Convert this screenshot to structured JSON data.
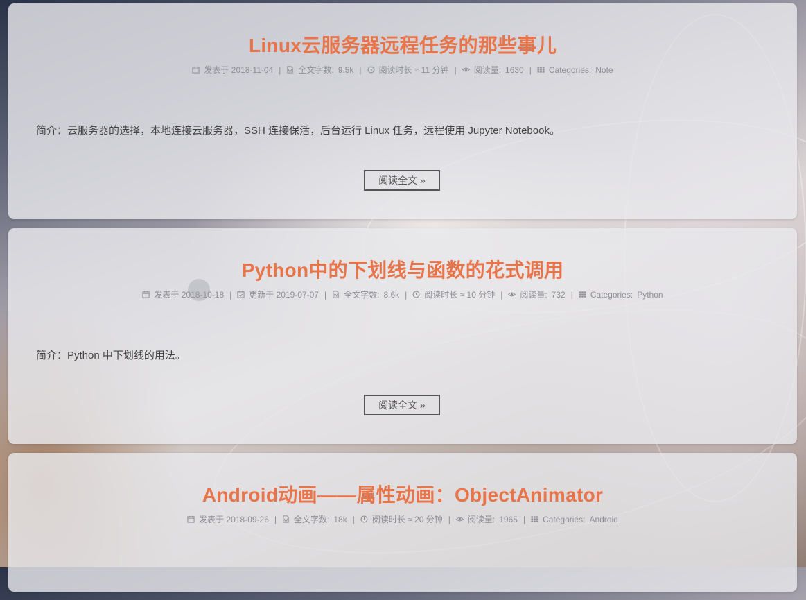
{
  "posts": [
    {
      "title": "Linux云服务器远程任务的那些事儿",
      "posted": "发表于 2018-11-04",
      "wordcount_label": "全文字数:",
      "wordcount": "9.5k",
      "readtime": "阅读时长 ≈ 11 分钟",
      "views_label": "阅读量:",
      "views": "1630",
      "categories_label": "Categories:",
      "category": "Note",
      "excerpt": "简介：云服务器的选择，本地连接云服务器，SSH 连接保活，后台运行 Linux 任务，远程使用 Jupyter Notebook。",
      "read_more": "阅读全文 »"
    },
    {
      "title": "Python中的下划线与函数的花式调用",
      "posted": "发表于 2018-10-18",
      "updated": "更新于 2019-07-07",
      "wordcount_label": "全文字数:",
      "wordcount": "8.6k",
      "readtime": "阅读时长 ≈ 10 分钟",
      "views_label": "阅读量:",
      "views": "732",
      "categories_label": "Categories:",
      "category": "Python",
      "excerpt": "简介：Python 中下划线的用法。",
      "read_more": "阅读全文 »"
    },
    {
      "title": "Android动画——属性动画：ObjectAnimator",
      "posted": "发表于 2018-09-26",
      "wordcount_label": "全文字数:",
      "wordcount": "18k",
      "readtime": "阅读时长 ≈ 20 分钟",
      "views_label": "阅读量:",
      "views": "1965",
      "categories_label": "Categories:",
      "category": "Android"
    }
  ],
  "colors": {
    "title": "#e8744a",
    "meta": "#8e8e96",
    "text": "#444444"
  },
  "icons": [
    "calendar-icon",
    "calendar-check-icon",
    "file-word-icon",
    "clock-icon",
    "eye-icon",
    "grid-icon"
  ]
}
